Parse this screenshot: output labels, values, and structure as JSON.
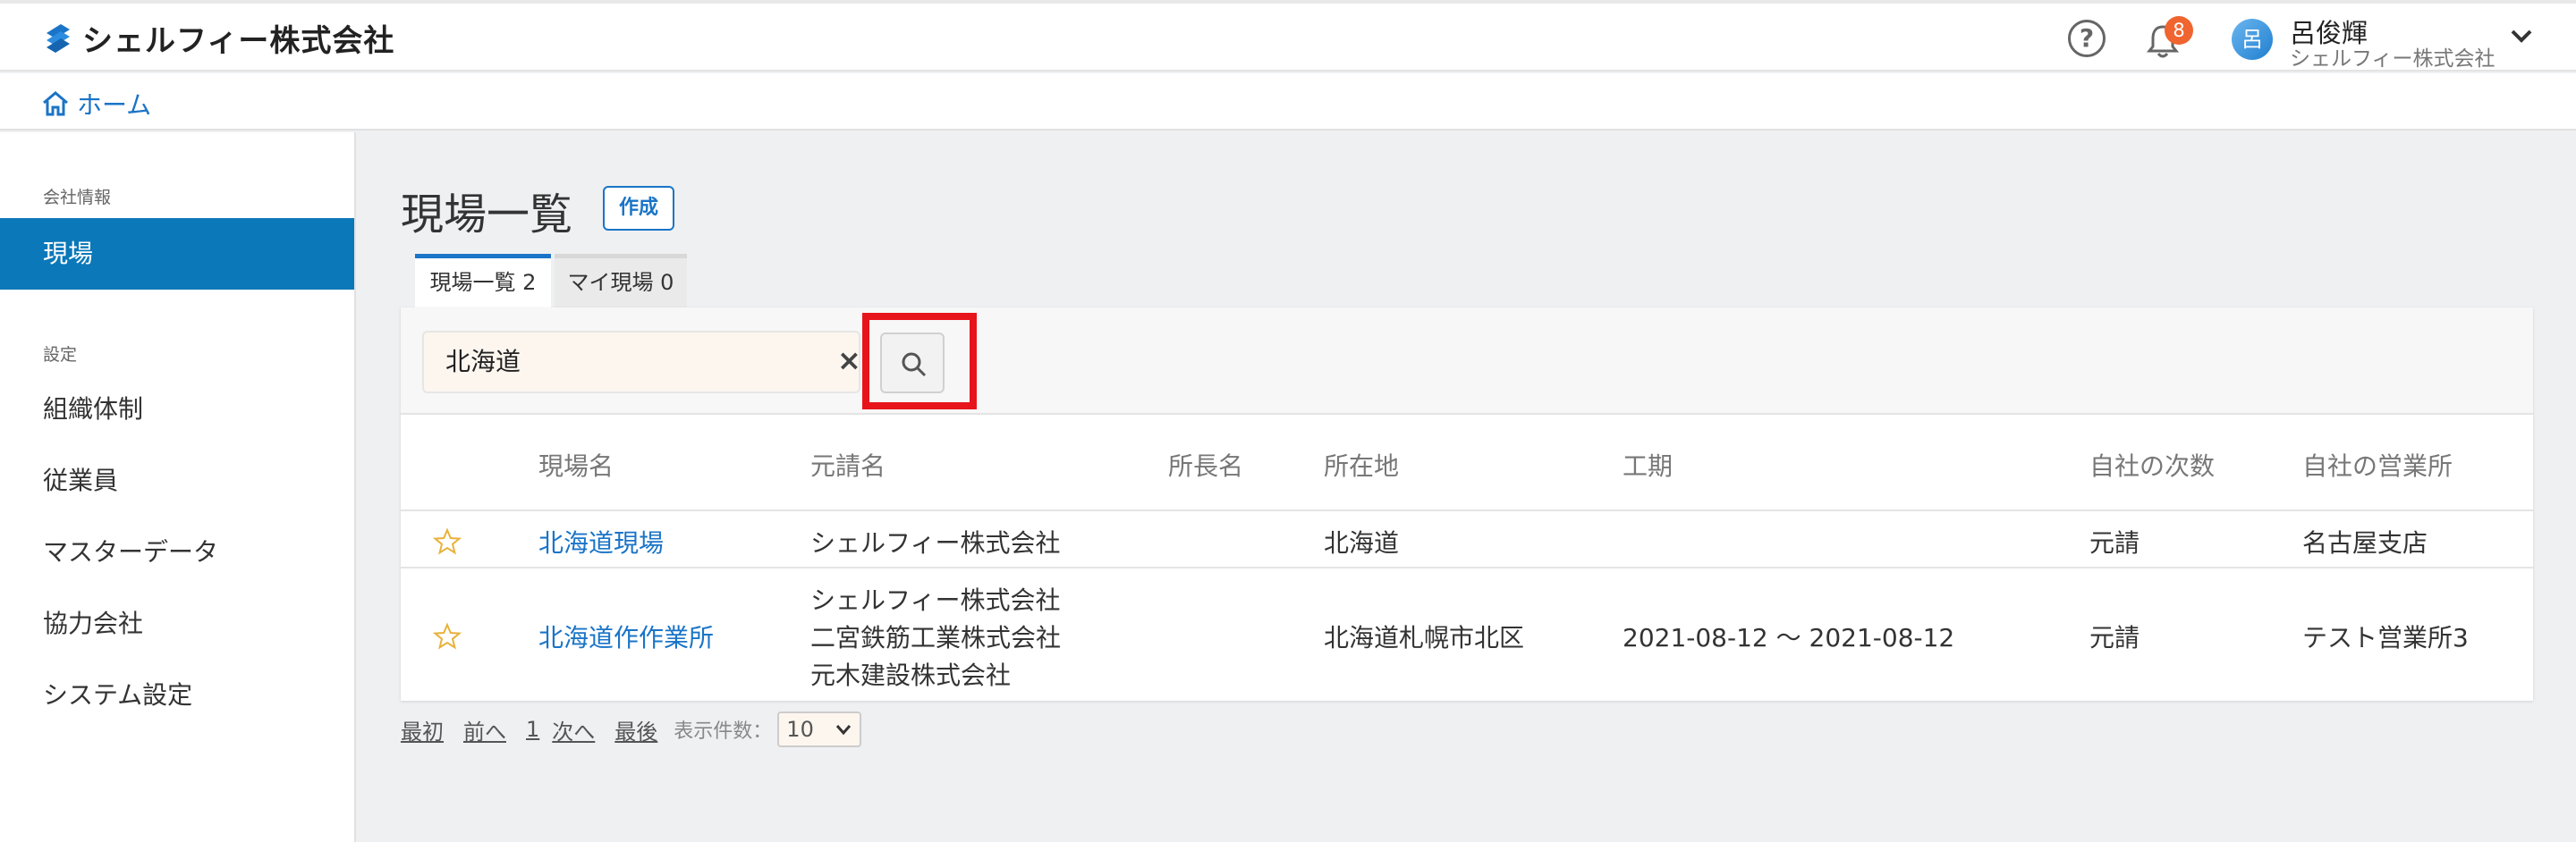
{
  "app": {
    "name": "シェルフィー株式会社"
  },
  "header": {
    "notifications_count": "8",
    "user": {
      "avatar_char": "呂",
      "name": "呂俊輝",
      "company": "シェルフィー株式会社"
    }
  },
  "breadcrumb": {
    "home": "ホーム"
  },
  "sidebar": {
    "section_company": "会社情報",
    "item_sites": "現場",
    "section_settings": "設定",
    "items": [
      "組織体制",
      "従業員",
      "マスターデータ",
      "協力会社",
      "システム設定"
    ]
  },
  "page": {
    "title": "現場一覧",
    "create_label": "作成"
  },
  "tabs": [
    {
      "label": "現場一覧 2"
    },
    {
      "label": "マイ現場 0"
    }
  ],
  "search": {
    "value": "北海道"
  },
  "table": {
    "columns": [
      "現場名",
      "元請名",
      "所長名",
      "所在地",
      "工期",
      "自社の次数",
      "自社の営業所"
    ],
    "rows": [
      {
        "name": "北海道現場",
        "contractors": [
          "シェルフィー株式会社"
        ],
        "manager": "",
        "location": "北海道",
        "period": "",
        "tier": "元請",
        "office": "名古屋支店"
      },
      {
        "name": "北海道作作業所",
        "contractors": [
          "シェルフィー株式会社",
          "二宮鉄筋工業株式会社",
          "元木建設株式会社"
        ],
        "manager": "",
        "location": "北海道札幌市北区",
        "period": "2021-08-12 〜 2021-08-12",
        "tier": "元請",
        "office": "テスト営業所3"
      }
    ]
  },
  "pager": {
    "first": "最初",
    "prev": "前へ",
    "page": "1",
    "next": "次へ",
    "last": "最後",
    "size_label": "表示件数：",
    "size_value": "10"
  },
  "colors": {
    "accent": "#1a74c7",
    "sidebar_active": "#0b78b9",
    "badge": "#f0642f",
    "highlight": "#e8141b"
  }
}
